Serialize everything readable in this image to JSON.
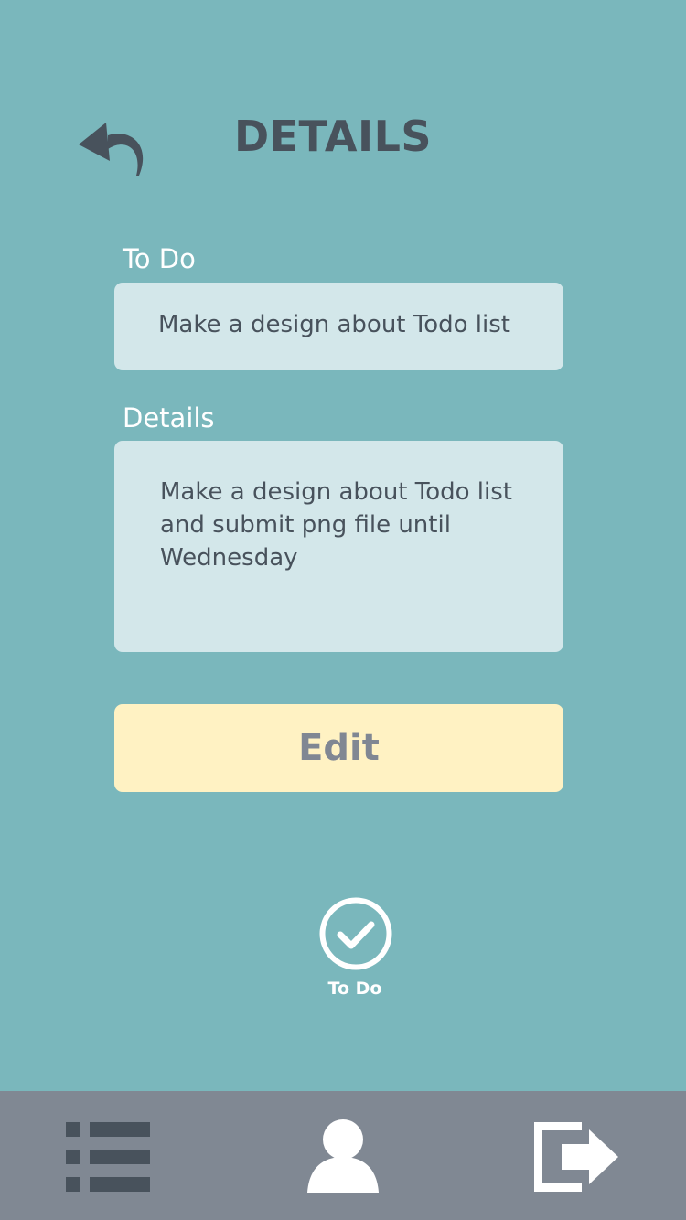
{
  "header": {
    "title": "DETAILS",
    "back_icon": "undo-arrow-icon"
  },
  "form": {
    "todo_label": "To Do",
    "todo_value": "Make a design about Todo list",
    "details_label": "Details",
    "details_value": "Make a design about Todo list and submit png file until Wednesday"
  },
  "actions": {
    "edit_label": "Edit"
  },
  "status": {
    "label": "To Do",
    "icon": "check-circle-icon"
  },
  "bottom_nav": {
    "items": [
      {
        "icon": "list-icon"
      },
      {
        "icon": "user-icon"
      },
      {
        "icon": "logout-icon"
      }
    ]
  },
  "colors": {
    "background": "#7ab7bc",
    "title_text": "#48525c",
    "field_background": "#d3e7ea",
    "edit_button_background": "#fff2c3",
    "edit_button_text": "#808793",
    "bottom_nav_background": "#808893",
    "nav_icon": "#48525c",
    "active_icon": "#ffffff"
  }
}
